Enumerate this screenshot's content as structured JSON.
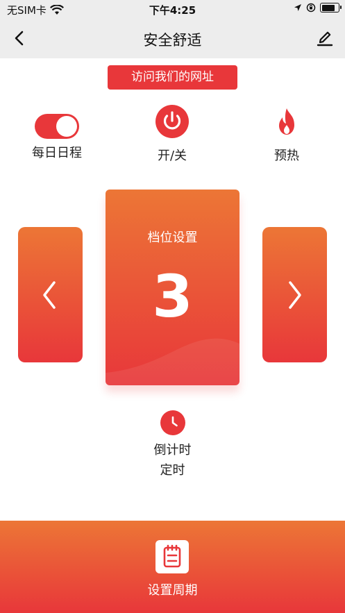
{
  "status_bar": {
    "carrier": "无SIM卡",
    "time": "下午4:25",
    "battery_level": 0.9
  },
  "nav": {
    "title": "安全舒适"
  },
  "visit_button": {
    "label": "访问我们的网址"
  },
  "controls": {
    "schedule_label": "每日日程",
    "schedule_on": true,
    "power_label": "开/关",
    "preheat_label": "预热"
  },
  "gear": {
    "label": "档位设置",
    "value": "3"
  },
  "timer": {
    "countdown_label": "倒计时",
    "timer_label": "定时"
  },
  "bottom": {
    "label": "设置周期"
  },
  "colors": {
    "accent": "#e8373a",
    "accent_orange": "#ec7636",
    "nav_bg": "#ededed"
  },
  "icons": [
    "wifi-icon",
    "location-icon",
    "lock-rotation-icon",
    "battery-icon",
    "back-arrow-icon",
    "edit-pen-icon",
    "power-icon",
    "flame-icon",
    "chevron-left-icon",
    "chevron-right-icon",
    "clock-icon",
    "notepad-icon"
  ]
}
